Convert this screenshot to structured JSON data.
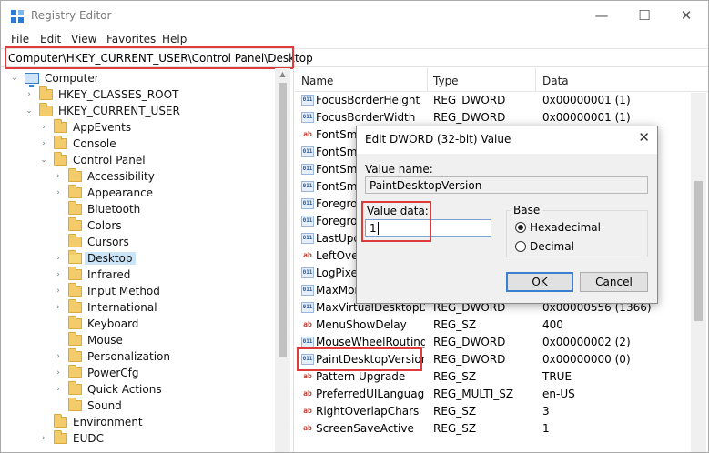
{
  "window": {
    "title": "Registry Editor",
    "minimize": "—",
    "maximize": "☐",
    "close": "✕"
  },
  "menu": [
    "File",
    "Edit",
    "View",
    "Favorites",
    "Help"
  ],
  "address": "Computer\\HKEY_CURRENT_USER\\Control Panel\\Desktop",
  "tree": [
    {
      "label": "Computer",
      "level": 0,
      "chev": "⌄",
      "icon": "computer-icon"
    },
    {
      "label": "HKEY_CLASSES_ROOT",
      "level": 1,
      "chev": "›",
      "icon": "folder-icon"
    },
    {
      "label": "HKEY_CURRENT_USER",
      "level": 1,
      "chev": "⌄",
      "icon": "folder-icon"
    },
    {
      "label": "AppEvents",
      "level": 2,
      "chev": "›",
      "icon": "folder-icon"
    },
    {
      "label": "Console",
      "level": 2,
      "chev": "›",
      "icon": "folder-icon"
    },
    {
      "label": "Control Panel",
      "level": 2,
      "chev": "⌄",
      "icon": "folder-icon"
    },
    {
      "label": "Accessibility",
      "level": 3,
      "chev": "›",
      "icon": "folder-icon"
    },
    {
      "label": "Appearance",
      "level": 3,
      "chev": "›",
      "icon": "folder-icon"
    },
    {
      "label": "Bluetooth",
      "level": 3,
      "chev": "",
      "icon": "folder-icon"
    },
    {
      "label": "Colors",
      "level": 3,
      "chev": "",
      "icon": "folder-icon"
    },
    {
      "label": "Cursors",
      "level": 3,
      "chev": "",
      "icon": "folder-icon"
    },
    {
      "label": "Desktop",
      "level": 3,
      "chev": "›",
      "icon": "folder-icon",
      "selected": true
    },
    {
      "label": "Infrared",
      "level": 3,
      "chev": "›",
      "icon": "folder-icon"
    },
    {
      "label": "Input Method",
      "level": 3,
      "chev": "›",
      "icon": "folder-icon"
    },
    {
      "label": "International",
      "level": 3,
      "chev": "›",
      "icon": "folder-icon"
    },
    {
      "label": "Keyboard",
      "level": 3,
      "chev": "",
      "icon": "folder-icon"
    },
    {
      "label": "Mouse",
      "level": 3,
      "chev": "",
      "icon": "folder-icon"
    },
    {
      "label": "Personalization",
      "level": 3,
      "chev": "›",
      "icon": "folder-icon"
    },
    {
      "label": "PowerCfg",
      "level": 3,
      "chev": "›",
      "icon": "folder-icon"
    },
    {
      "label": "Quick Actions",
      "level": 3,
      "chev": "›",
      "icon": "folder-icon"
    },
    {
      "label": "Sound",
      "level": 3,
      "chev": "",
      "icon": "folder-icon"
    },
    {
      "label": "Environment",
      "level": 2,
      "chev": "",
      "icon": "folder-icon"
    },
    {
      "label": "EUDC",
      "level": 2,
      "chev": "›",
      "icon": "folder-icon"
    }
  ],
  "list": {
    "headers": [
      "Name",
      "Type",
      "Data"
    ],
    "rows": [
      {
        "name": "FocusBorderHeight",
        "type": "REG_DWORD",
        "data": "0x00000001 (1)",
        "kind": "dword"
      },
      {
        "name": "FocusBorderWidth",
        "type": "REG_DWORD",
        "data": "0x00000001 (1)",
        "kind": "dword"
      },
      {
        "name": "FontSmo",
        "type": "",
        "data": "",
        "kind": "sz"
      },
      {
        "name": "FontSmo",
        "type": "",
        "data": "",
        "kind": "dword"
      },
      {
        "name": "FontSmo",
        "type": "",
        "data": "",
        "kind": "dword"
      },
      {
        "name": "FontSmo",
        "type": "",
        "data": "",
        "kind": "dword"
      },
      {
        "name": "Foregrou",
        "type": "",
        "data": "",
        "kind": "dword"
      },
      {
        "name": "Foregrou",
        "type": "",
        "data": "",
        "kind": "dword"
      },
      {
        "name": "LastUpd",
        "type": "",
        "data": "",
        "kind": "dword"
      },
      {
        "name": "LeftOver",
        "type": "",
        "data": "",
        "kind": "sz"
      },
      {
        "name": "LogPixel",
        "type": "",
        "data": "",
        "kind": "dword"
      },
      {
        "name": "MaxMon",
        "type": "",
        "data": "",
        "kind": "dword"
      },
      {
        "name": "MaxVirtualDesktopDi...",
        "type": "REG_DWORD",
        "data": "0x00000556 (1366)",
        "kind": "dword"
      },
      {
        "name": "MenuShowDelay",
        "type": "REG_SZ",
        "data": "400",
        "kind": "sz"
      },
      {
        "name": "MouseWheelRouting",
        "type": "REG_DWORD",
        "data": "0x00000002 (2)",
        "kind": "dword"
      },
      {
        "name": "PaintDesktopVersion",
        "type": "REG_DWORD",
        "data": "0x00000000 (0)",
        "kind": "dword"
      },
      {
        "name": "Pattern Upgrade",
        "type": "REG_SZ",
        "data": "TRUE",
        "kind": "sz"
      },
      {
        "name": "PreferredUILanguages",
        "type": "REG_MULTI_SZ",
        "data": "en-US",
        "kind": "sz"
      },
      {
        "name": "RightOverlapChars",
        "type": "REG_SZ",
        "data": "3",
        "kind": "sz"
      },
      {
        "name": "ScreenSaveActive",
        "type": "REG_SZ",
        "data": "1",
        "kind": "sz"
      }
    ]
  },
  "dialog": {
    "title": "Edit DWORD (32-bit) Value",
    "close": "✕",
    "value_name_label": "Value name:",
    "value_name": "PaintDesktopVersion",
    "value_data_label": "Value data:",
    "value_data": "1",
    "base_label": "Base",
    "hex_label": "Hexadecimal",
    "dec_label": "Decimal",
    "base_selected": "hexadecimal",
    "ok": "OK",
    "cancel": "Cancel"
  },
  "icon_labels": {
    "sz": "ab",
    "dword": "011"
  },
  "colors": {
    "highlight_border": "#e03b3b",
    "selection": "#cce4f7"
  }
}
